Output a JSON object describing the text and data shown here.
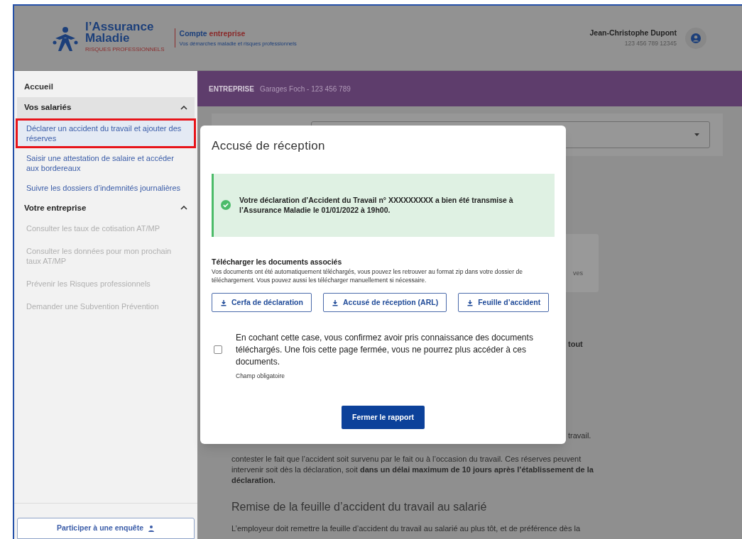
{
  "header": {
    "logo": {
      "line1": "l’Assurance",
      "line2": "Maladie",
      "tagline": "RISQUES PROFESSIONNELS"
    },
    "account": {
      "title": "Compte",
      "title_accent": "entreprise",
      "subtitle": "Vos démarches maladie et risques professionnels"
    },
    "user": {
      "name": "Jean-Christophe Dupont",
      "number": "123 456 789 12345"
    }
  },
  "sidebar": {
    "items": [
      {
        "kind": "link",
        "label": "Accueil"
      },
      {
        "kind": "section",
        "label": "Vos salariés",
        "expanded": true,
        "children": [
          {
            "label": "Déclarer un accident du travail et ajouter des réserves",
            "selected": true,
            "disabled": false
          },
          {
            "label": "Saisir une attestation de salaire et accéder aux bordereaux",
            "selected": false,
            "disabled": false
          },
          {
            "label": "Suivre les dossiers d’indemnités journalières",
            "selected": false,
            "disabled": false
          }
        ]
      },
      {
        "kind": "section",
        "label": "Votre entreprise",
        "expanded": true,
        "children": [
          {
            "label": "Consulter les taux de cotisation AT/MP",
            "selected": false,
            "disabled": true
          },
          {
            "label": "Consulter les données pour mon prochain taux AT/MP",
            "selected": false,
            "disabled": true
          },
          {
            "label": "Prévenir les Risques professionnels",
            "selected": false,
            "disabled": true
          },
          {
            "label": "Demander une Subvention Prévention",
            "selected": false,
            "disabled": true
          }
        ]
      }
    ],
    "survey_button": "Participer à une enquête"
  },
  "company_bar": {
    "label": "ENTREPRISE",
    "value": "Garages Foch - 123 456 789"
  },
  "background": {
    "card_fragment": "ves",
    "bold_fragment": "tout",
    "line_end": "travail.",
    "paragraph": "contester le fait que l’accident soit survenu par le fait ou à l’occasion du travail. Ces réserves peuvent intervenir soit dès la déclaration, soit **dans un délai maximum de 10 jours après l’établissement de la déclaration.**",
    "heading": "Remise de la feuille d’accident du travail au salarié",
    "paragraph_2": "L’employeur doit remettre la feuille d’accident du travail au salarié au plus tôt, et de préférence dès la"
  },
  "modal": {
    "title": "Accusé de réception",
    "alert": {
      "message": "Votre déclaration d’Accident du Travail n° XXXXXXXXX a bien été transmise à l’Assurance Maladie le 01/01/2022 à 19h00."
    },
    "downloads": {
      "title": "Télécharger les documents associés",
      "description": "Vos documents ont été automatiquement téléchargés, vous pouvez les retrouver au format zip dans votre dossier de téléchargement. Vous pouvez aussi les télécharger manuellement si nécessaire.",
      "buttons": [
        "Cerfa de déclaration",
        "Accusé de réception (ARL)",
        "Feuille d’accident"
      ]
    },
    "confirmation": {
      "checked": false,
      "text": "En cochant cette case, vous confirmez avoir pris connaissance des documents téléchargés. Une fois cette page fermée, vous ne pourrez plus accéder à ces documents.",
      "hint": "Champ obligatoire"
    },
    "close_button": "Fermer le rapport"
  }
}
